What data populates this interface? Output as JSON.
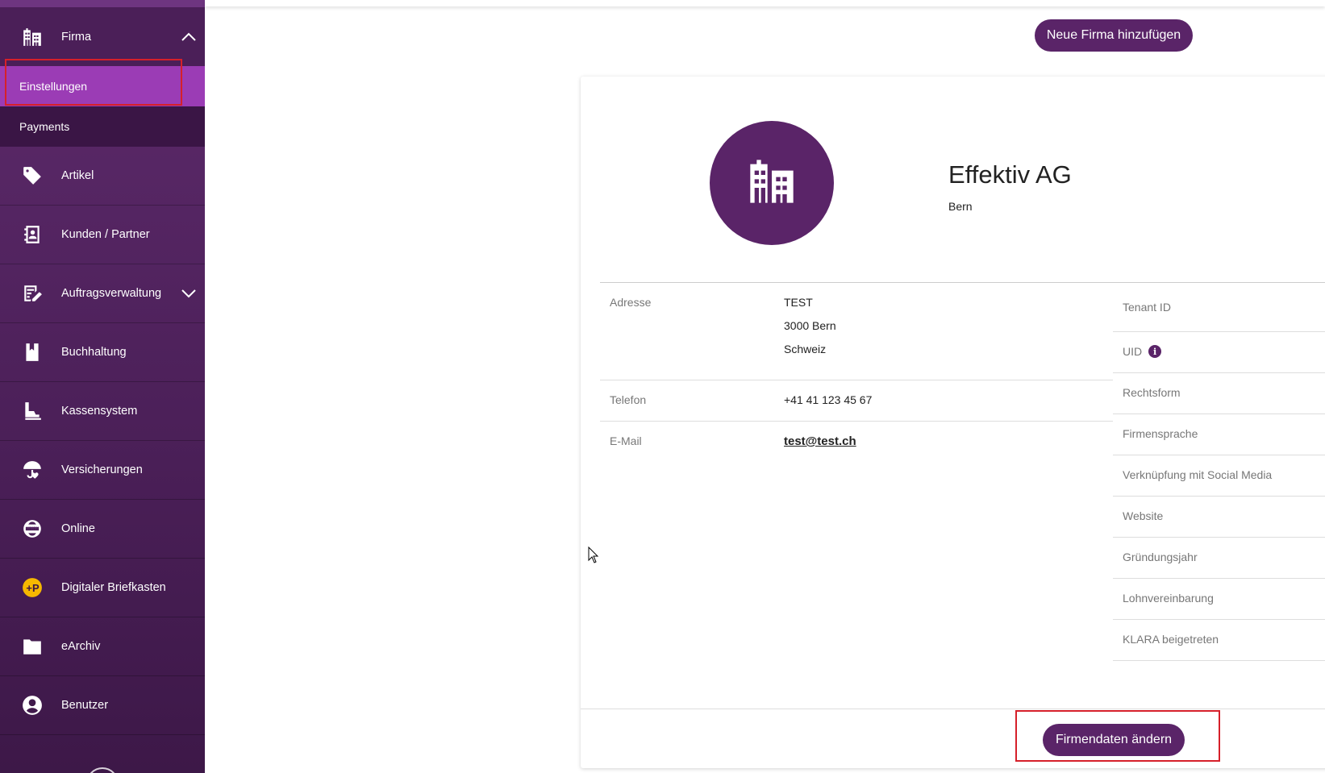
{
  "sidebar": {
    "firma": {
      "label": "Firma",
      "icon": "building-icon"
    },
    "sub_items": [
      {
        "label": "Einstellungen"
      },
      {
        "label": "Payments"
      }
    ],
    "items": [
      {
        "label": "Artikel",
        "icon": "tag-icon"
      },
      {
        "label": "Kunden / Partner",
        "icon": "contact-book-icon"
      },
      {
        "label": "Auftragsverwaltung",
        "icon": "checklist-edit-icon"
      },
      {
        "label": "Buchhaltung",
        "icon": "bookmark-book-icon"
      },
      {
        "label": "Kassensystem",
        "icon": "cash-register-icon"
      },
      {
        "label": "Versicherungen",
        "icon": "umbrella-heart-icon"
      },
      {
        "label": "Online",
        "icon": "www-globe-icon"
      },
      {
        "label": "Digitaler Briefkasten",
        "icon": "post-logo-icon"
      },
      {
        "label": "eArchiv",
        "icon": "folder-icon"
      },
      {
        "label": "Benutzer",
        "icon": "user-circle-icon"
      }
    ]
  },
  "header": {
    "add_company_label": "Neue Firma hinzufügen"
  },
  "company": {
    "name": "Effektiv AG",
    "city": "Bern",
    "address_label": "Adresse",
    "address_lines": [
      "TEST",
      "3000 Bern",
      "Schweiz"
    ],
    "phone_label": "Telefon",
    "phone": "+41 41 123 45 67",
    "email_label": "E-Mail",
    "email": "test@test.ch"
  },
  "details": [
    {
      "label": "Tenant ID"
    },
    {
      "label": "UID",
      "info": "i"
    },
    {
      "label": "Rechtsform"
    },
    {
      "label": "Firmensprache"
    },
    {
      "label": "Verknüpfung mit Social Media"
    },
    {
      "label": "Website"
    },
    {
      "label": "Gründungsjahr"
    },
    {
      "label": "Lohnvereinbarung"
    },
    {
      "label": "KLARA beigetreten"
    }
  ],
  "footer": {
    "edit_label": "Firmendaten ändern"
  },
  "colors": {
    "primary": "#5a2468",
    "active": "#9b3cb5",
    "highlight": "#d6202a"
  }
}
